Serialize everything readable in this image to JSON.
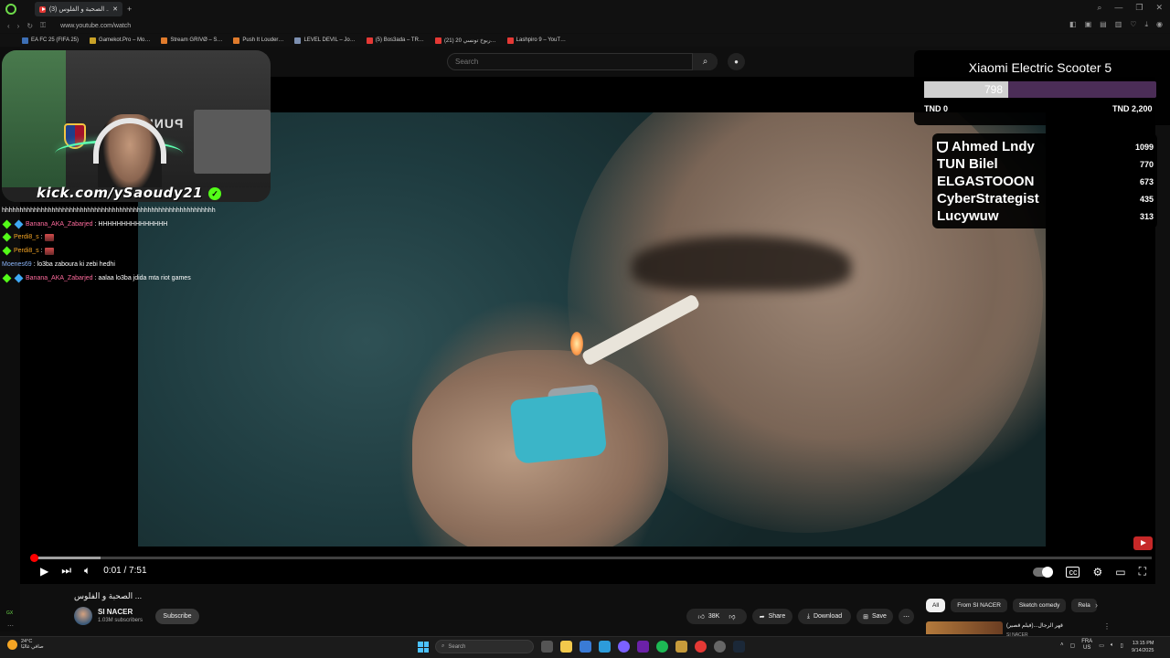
{
  "browser": {
    "tab_title": "(3) الصحبة و الفلوس ... - You",
    "url": "www.youtube.com/watch",
    "bookmarks": [
      {
        "label": "EA FC 25 (FIFA 25)",
        "color": "#3d6fb5"
      },
      {
        "label": "Gamekot.Pro – Mo…",
        "color": "#c9a227"
      },
      {
        "label": "Stream GRIVØ – S…",
        "color": "#e07b2c"
      },
      {
        "label": "Push It Louder…",
        "color": "#e07b2c"
      },
      {
        "label": "LEVEL DEVIL – Jo…",
        "color": "#7c8fb0"
      },
      {
        "label": "(5) Bos3ada – TR…",
        "color": "#e53935"
      },
      {
        "label": "(21) ربوخ تونسي 20…",
        "color": "#e53935"
      },
      {
        "label": "Lashpiro 9 – YouT…",
        "color": "#e53935"
      }
    ]
  },
  "youtube": {
    "search_placeholder": "Search",
    "video": {
      "current_time": "0:01",
      "duration": "7:51",
      "time_display": "0:01 / 7:51",
      "title": "الصحبة و الفلوس ..."
    },
    "channel": {
      "name": "SI NACER",
      "subscribers": "1.03M subscribers"
    },
    "subscribe_label": "Subscribe",
    "actions": {
      "likes": "38K",
      "share": "Share",
      "download": "Download",
      "save": "Save"
    },
    "chips": [
      "All",
      "From SI NACER",
      "Sketch comedy",
      "Rela"
    ],
    "recommendation": {
      "title": "قهر الرجال...(فيلم قصير)",
      "channel": "SI NACER"
    }
  },
  "stream": {
    "webcam_caption": "kick.com/ySaoudy21",
    "punisher_text": "PUNISHER",
    "chat": [
      {
        "user": "",
        "user_color": "#ffffff",
        "message": "hhhhhhhhhhhhhhhhhhhhhhhhhhhhhhhhhhhhhhhhhhhhhhhhhhhhhhhhhhhh",
        "badges": 0,
        "emote": false
      },
      {
        "user": "Banana_AKA_Zabarjed",
        "user_color": "#ff6b9d",
        "message": "HHHHHHHHHHHHHHH",
        "badges": 2,
        "emote": false
      },
      {
        "user": "Perdi8_s",
        "user_color": "#f5a524",
        "message": "",
        "badges": 1,
        "emote": true
      },
      {
        "user": "Perdi8_s",
        "user_color": "#f5a524",
        "message": "",
        "badges": 1,
        "emote": true
      },
      {
        "user": "Moenes69",
        "user_color": "#8ab4f8",
        "message": "lo3ba zaboura ki zebi hedhi",
        "badges": 0,
        "emote": false
      },
      {
        "user": "Banana_AKA_Zabarjed",
        "user_color": "#ff6b9d",
        "message": "aalaa lo3ba jdida mta riot games",
        "badges": 2,
        "emote": false
      }
    ],
    "goal": {
      "title": "Xiaomi Electric Scooter 5",
      "current": "798",
      "progress_fraction": 0.3627,
      "min_label": "TND 0",
      "max_label": "TND 2,200"
    },
    "leaderboard": [
      {
        "name": "Ahmed Lndy",
        "score": "1099",
        "trophy": true
      },
      {
        "name": "TUN Bilel",
        "score": "770",
        "trophy": false
      },
      {
        "name": "ELGASTOOON",
        "score": "673",
        "trophy": false
      },
      {
        "name": "CyberStrategist",
        "score": "435",
        "trophy": false
      },
      {
        "name": "Lucywuw",
        "score": "313",
        "trophy": false
      }
    ]
  },
  "taskbar": {
    "weather_temp": "24°C",
    "weather_desc": "صافي غالبًا",
    "search_placeholder": "Search",
    "lang_top": "FRA",
    "lang_bottom": "US",
    "time": "13:15 PM",
    "date": "9/14/2025"
  }
}
